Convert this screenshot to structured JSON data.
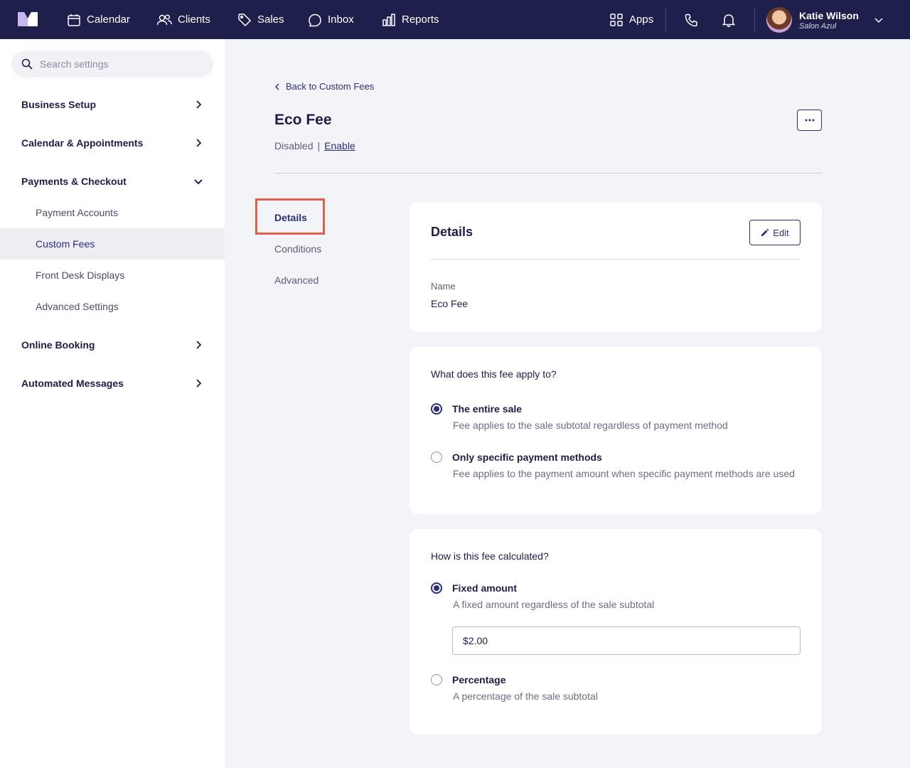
{
  "colors": {
    "nav_bg": "#1e1f4b",
    "accent": "#2a2f7a",
    "highlight": "#e0604a",
    "page_bg": "#f3f4f7"
  },
  "topnav": {
    "items": [
      {
        "label": "Calendar",
        "icon": "calendar-icon"
      },
      {
        "label": "Clients",
        "icon": "users-icon"
      },
      {
        "label": "Sales",
        "icon": "tag-icon"
      },
      {
        "label": "Inbox",
        "icon": "chat-icon"
      },
      {
        "label": "Reports",
        "icon": "bar-chart-icon"
      }
    ],
    "apps_label": "Apps",
    "user": {
      "name": "Katie Wilson",
      "salon": "Salon Azul"
    }
  },
  "sidebar": {
    "search_placeholder": "Search settings",
    "sections": [
      {
        "label": "Business Setup",
        "expanded": false
      },
      {
        "label": "Calendar & Appointments",
        "expanded": false
      },
      {
        "label": "Payments & Checkout",
        "expanded": true
      },
      {
        "label": "Online Booking",
        "expanded": false
      },
      {
        "label": "Automated Messages",
        "expanded": false
      }
    ],
    "payments_items": [
      "Payment Accounts",
      "Custom Fees",
      "Front Desk Displays",
      "Advanced Settings"
    ],
    "active_item": "Custom Fees"
  },
  "main": {
    "back_label": "Back to Custom Fees",
    "title": "Eco Fee",
    "status": "Disabled",
    "status_separator": "|",
    "enable_label": "Enable",
    "subtabs": [
      "Details",
      "Conditions",
      "Advanced"
    ],
    "active_subtab": "Details"
  },
  "details_card": {
    "title": "Details",
    "edit_label": "Edit",
    "name_label": "Name",
    "name_value": "Eco Fee"
  },
  "applies_card": {
    "question": "What does this fee apply to?",
    "options": [
      {
        "title": "The entire sale",
        "desc": "Fee applies to the sale subtotal regardless of payment method",
        "checked": true
      },
      {
        "title": "Only specific payment methods",
        "desc": "Fee applies to the payment amount when specific payment methods are used",
        "checked": false
      }
    ]
  },
  "calc_card": {
    "question": "How is this fee calculated?",
    "options": [
      {
        "title": "Fixed amount",
        "desc": "A fixed amount regardless of the sale subtotal",
        "checked": true
      },
      {
        "title": "Percentage",
        "desc": "A percentage of the sale subtotal",
        "checked": false
      }
    ],
    "amount_value": "$2.00"
  }
}
